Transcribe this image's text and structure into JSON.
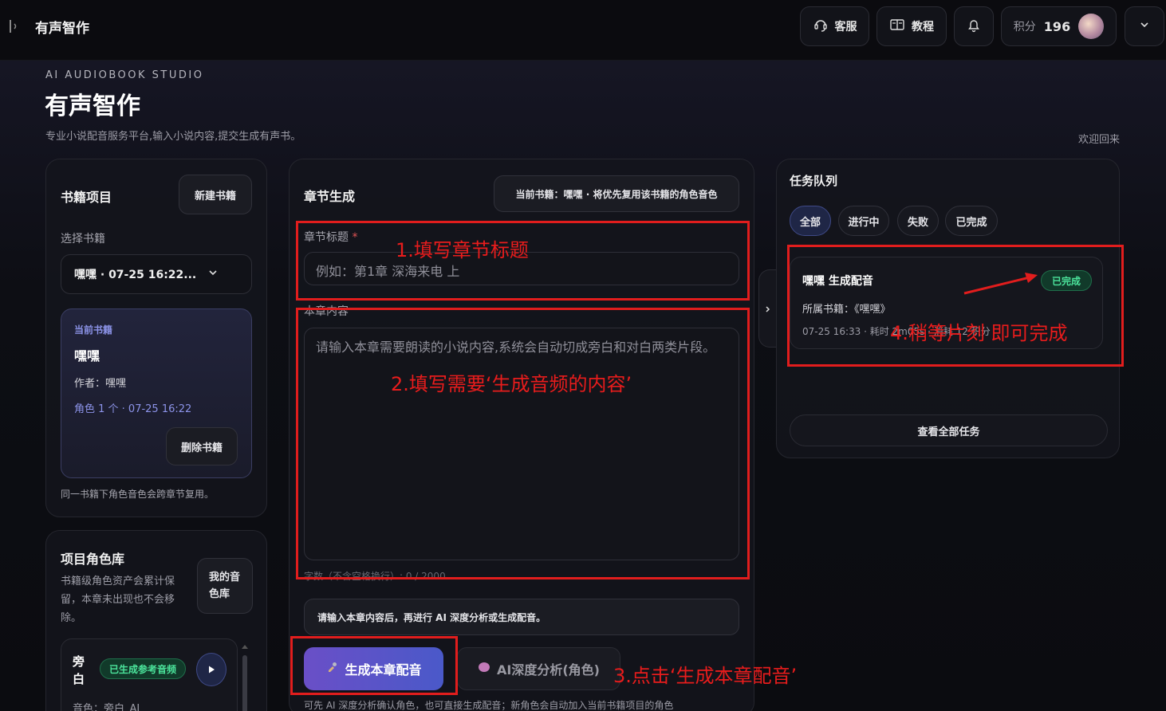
{
  "topbar": {
    "app_title": "有声智作",
    "support_label": "客服",
    "tutorial_label": "教程",
    "points_label": "积分",
    "points_value": "196"
  },
  "hero": {
    "eyebrow": "AI AUDIOBOOK STUDIO",
    "title": "有声智作",
    "subtitle": "专业小说配音服务平台,输入小说内容,提交生成有声书。",
    "welcome": "欢迎回来"
  },
  "books": {
    "title": "书籍项目",
    "new_button": "新建书籍",
    "select_label": "选择书籍",
    "selected": "嘿嘿 · 07-25 16:22...",
    "current_tag": "当前书籍",
    "current_name": "嘿嘿",
    "author": "作者：嘿嘿",
    "roles_meta": "角色 1 个 · 07-25 16:22",
    "delete_button": "删除书籍",
    "note": "同一书籍下角色音色会跨章节复用。"
  },
  "roles": {
    "title": "项目角色库",
    "desc": "书籍级角色资产会累计保留，本章未出现也不会移除。",
    "my_voice_button": "我的音色库",
    "item_name": "旁白",
    "item_badge": "已生成参考音频",
    "item_voice": "音色：旁白_AI"
  },
  "chapter": {
    "title": "章节生成",
    "current_book_note": "当前书籍：嘿嘿 · 将优先复用该书籍的角色音色",
    "title_label": "章节标题",
    "required_mark": "*",
    "title_placeholder": "例如：第1章 深海来电 上",
    "content_label": "本章内容",
    "content_placeholder": "请输入本章需要朗读的小说内容,系统会自动切成旁白和对白两类片段。",
    "word_count": "字数（不含空格换行）: 0 / 2000",
    "hint": "请输入本章内容后，再进行 AI 深度分析或生成配音。",
    "generate_button": "生成本章配音",
    "analyze_button": "AI深度分析(角色)",
    "footer_note": "可先 AI 深度分析确认角色，也可直接生成配音；新角色会自动加入当前书籍项目的角色"
  },
  "queue": {
    "title": "任务队列",
    "tabs": [
      "全部",
      "进行中",
      "失败",
      "已完成"
    ],
    "task_title": "嘿嘿 生成配音",
    "task_status": "已完成",
    "task_book": "所属书籍：《嘿嘿》",
    "task_meta": "07-25 16:33 · 耗时 2m05s · 消耗 12 积分",
    "view_all": "查看全部任务"
  },
  "annotations": {
    "step1": "1.填写章节标题",
    "step2": "2.填写需要‘生成音频的内容’",
    "step3": "3.点击‘生成本章配音’",
    "step4": "4.稍等片刻 即可完成"
  },
  "colors": {
    "accent": "#5b5fd6",
    "success": "#4be39b",
    "annotation": "#e11d1d"
  }
}
